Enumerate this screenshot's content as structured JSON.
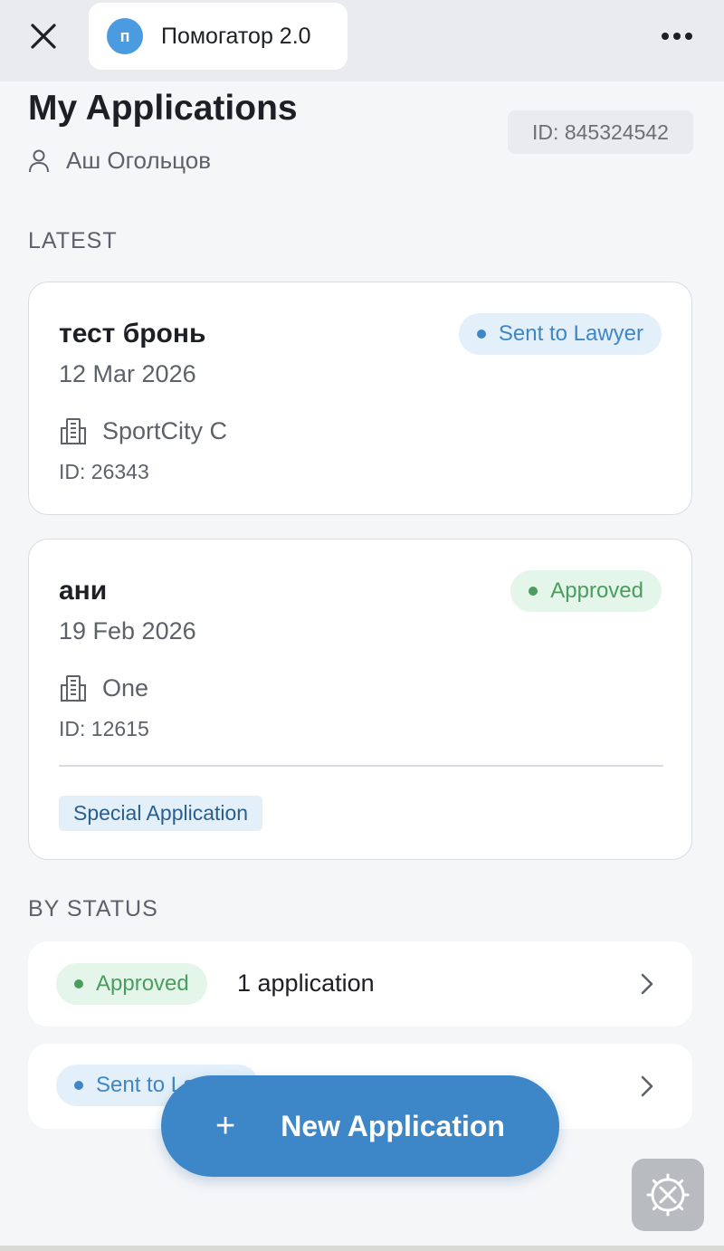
{
  "topbar": {
    "app_logo_letter": "п",
    "app_title": "Помогатор 2.0"
  },
  "header": {
    "title": "My Applications",
    "user_name": "Аш Огольцов",
    "user_id": "ID: 845324542"
  },
  "latest": {
    "section_label": "LATEST",
    "items": [
      {
        "title": "тест бронь",
        "date": "12 Mar 2026",
        "place": "SportCity C",
        "id": "ID: 26343",
        "status": "Sent to Lawyer"
      },
      {
        "title": "ани",
        "date": "19 Feb 2026",
        "place": "One",
        "id": "ID: 12615",
        "status": "Approved",
        "tag": "Special Application"
      }
    ]
  },
  "by_status": {
    "section_label": "BY STATUS",
    "rows": [
      {
        "status": "Approved",
        "count": "1 application"
      },
      {
        "status": "Sent to Lawyer"
      }
    ]
  },
  "fab": {
    "plus": "+",
    "label": "New Application"
  },
  "colors": {
    "accent": "#3d87c9",
    "status_blue": "#3e86c6",
    "status_green": "#4a9d5f"
  }
}
